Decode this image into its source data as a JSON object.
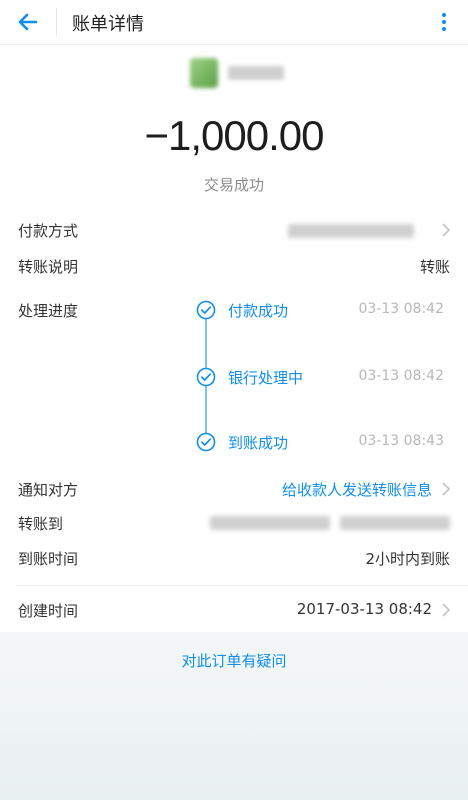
{
  "header": {
    "title": "账单详情",
    "back_icon": "arrow-left-icon",
    "more_icon": "more-vertical-icon"
  },
  "summary": {
    "amount": "−1,000.00",
    "status": "交易成功"
  },
  "details": {
    "payment_method_label": "付款方式",
    "transfer_note_label": "转账说明",
    "transfer_note_value": "转账",
    "progress_label": "处理进度",
    "notify_label": "通知对方",
    "notify_value": "给收款人发送转账信息",
    "transfer_to_label": "转账到",
    "arrival_time_label": "到账时间",
    "arrival_time_value": "2小时内到账",
    "created_label": "创建时间",
    "created_value": "2017-03-13 08:42"
  },
  "progress": [
    {
      "label": "付款成功",
      "time": "03-13 08:42"
    },
    {
      "label": "银行处理中",
      "time": "03-13 08:42"
    },
    {
      "label": "到账成功",
      "time": "03-13 08:43"
    }
  ],
  "footer": {
    "question_link": "对此订单有疑问"
  },
  "colors": {
    "accent": "#108ee9",
    "text": "#333333",
    "muted": "#8b8b8b"
  }
}
